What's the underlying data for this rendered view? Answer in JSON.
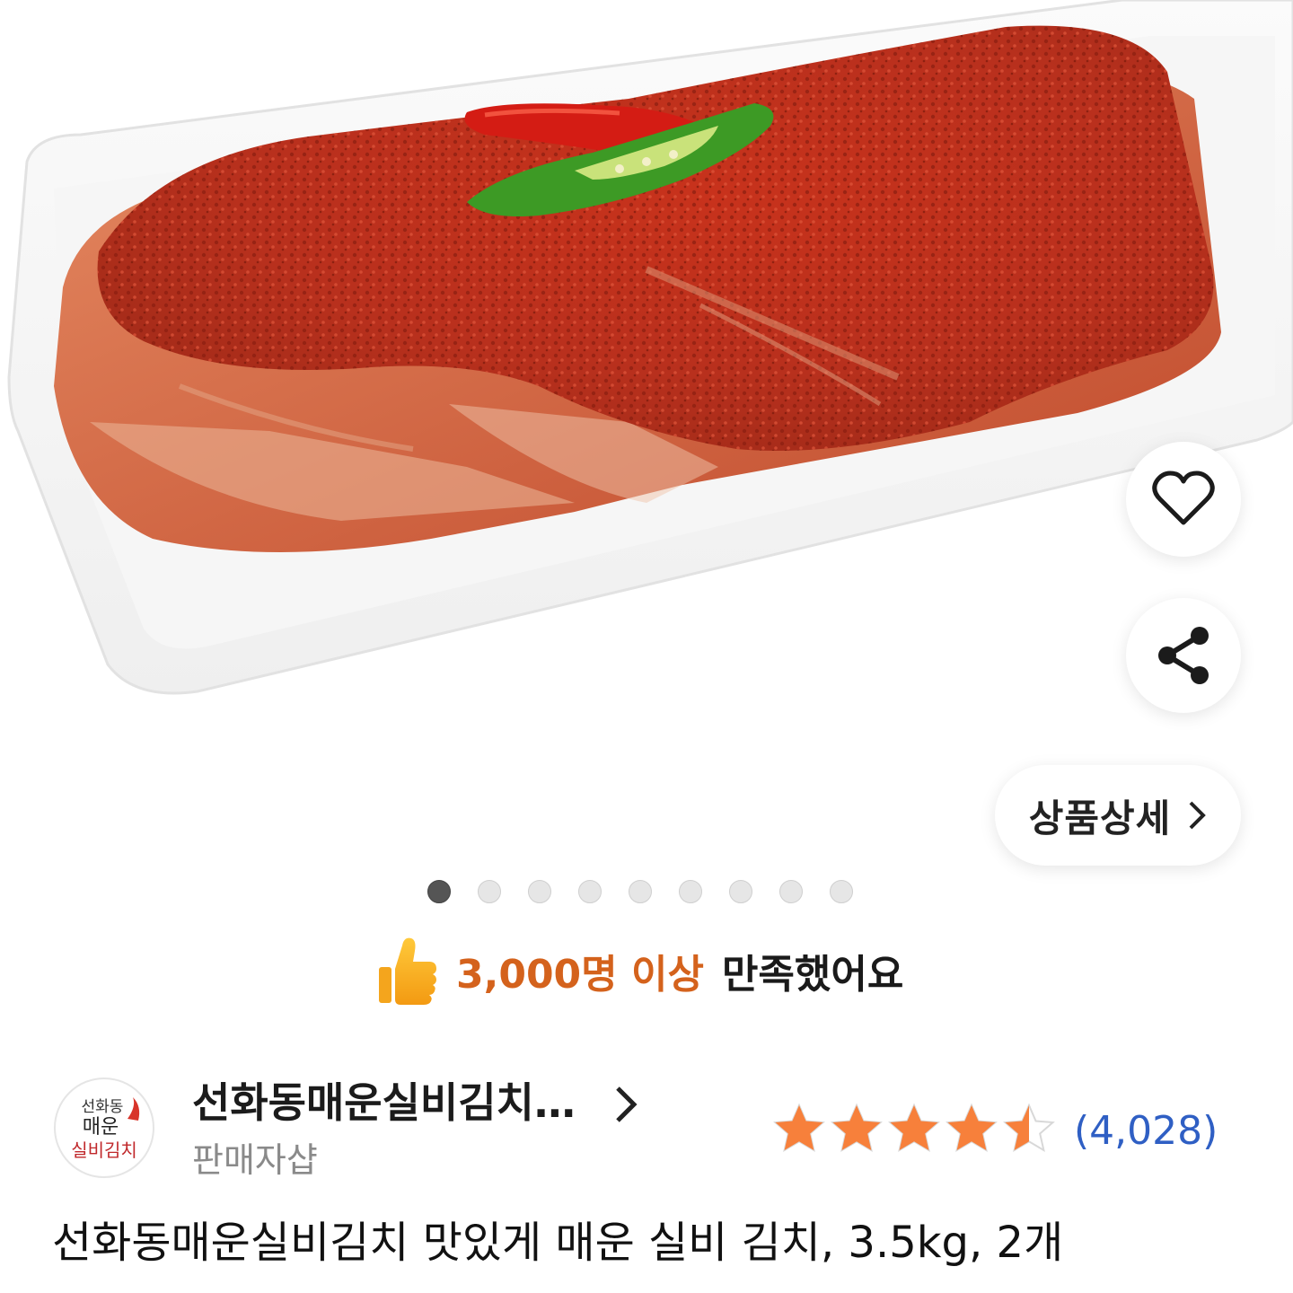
{
  "product_image": {
    "description": "product photo",
    "carousel": {
      "total": 9,
      "active_index": 0
    }
  },
  "actions": {
    "wishlist_icon": "heart-outline-icon",
    "share_icon": "share-icon",
    "detail_label": "상품상세",
    "detail_icon": "chevron-right-icon"
  },
  "satisfaction": {
    "icon": "thumbs-up-icon",
    "highlight": "3,000명 이상",
    "text": "만족했어요",
    "highlight_color": "#d4621c"
  },
  "seller": {
    "logo_lines": [
      "선화동",
      "매운",
      "실비김치"
    ],
    "name": "선화동매운실비김치…",
    "subtitle": "판매자샵",
    "rating": 4.5,
    "rating_max": 5,
    "review_count": "(4,028)",
    "star_color": "#f7803b",
    "link_color": "#2f5fc4"
  },
  "product": {
    "title": "선화동매운실비김치 맛있게 매운 실비 김치, 3.5kg, 2개"
  }
}
